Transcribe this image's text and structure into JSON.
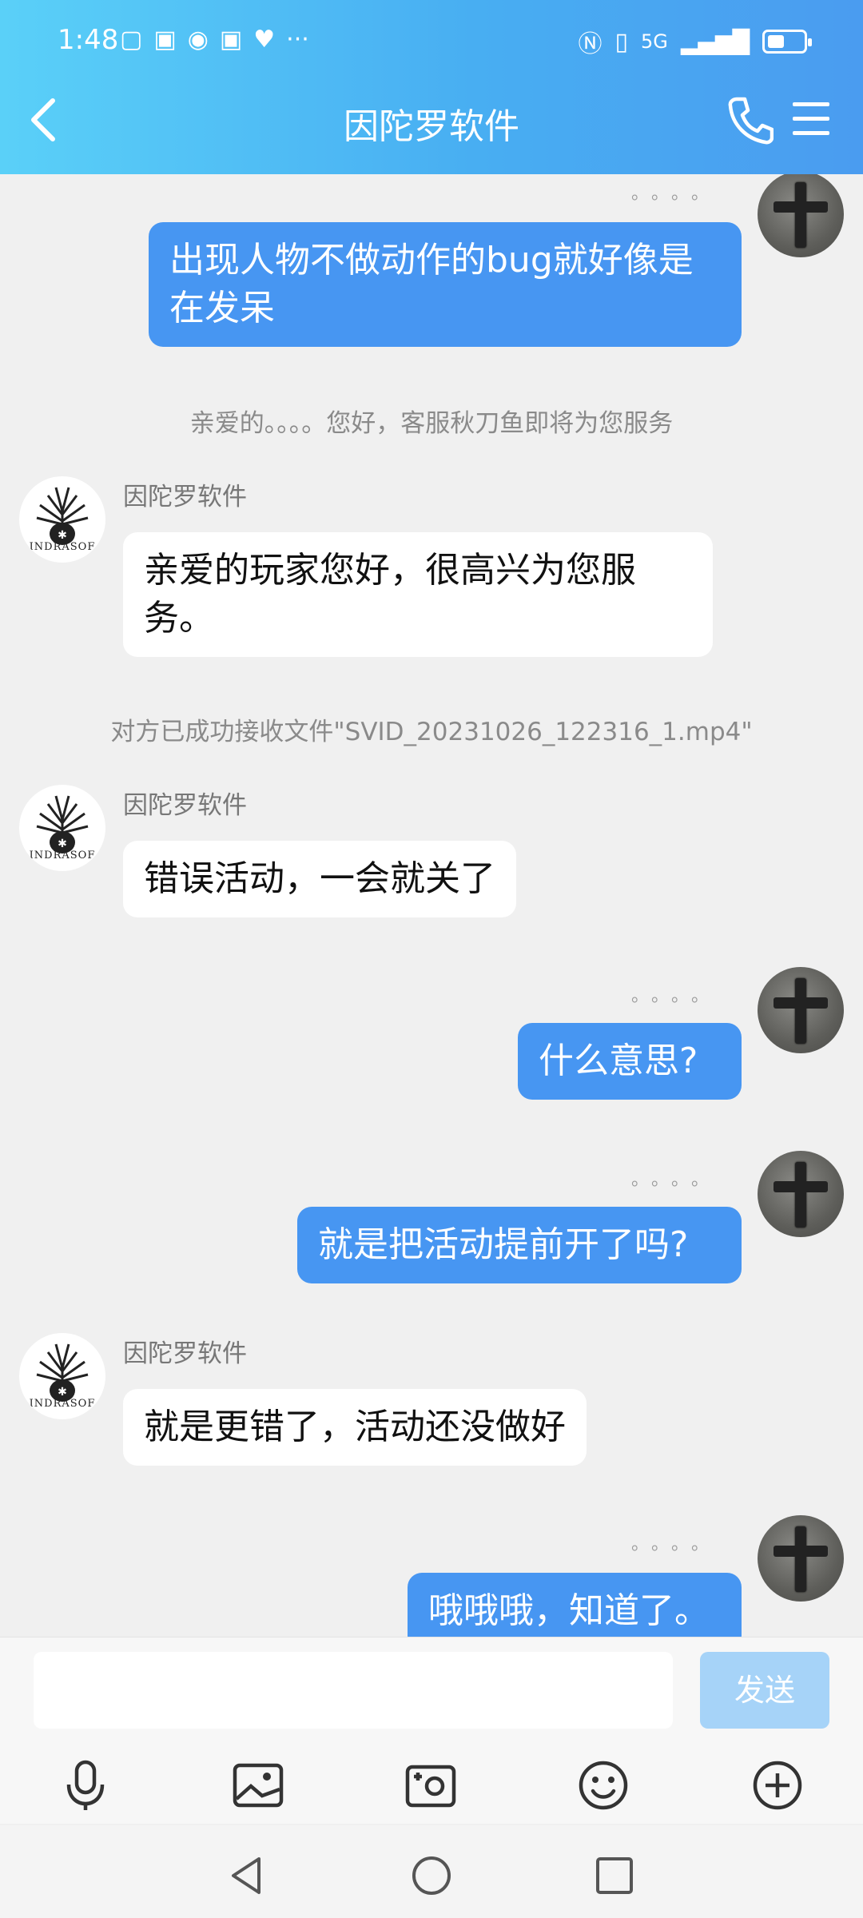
{
  "status_bar": {
    "time": "1:48",
    "left_icons": [
      "tv-icon",
      "app-icon",
      "play-icon",
      "app-icon",
      "heart-icon",
      "more-icon"
    ],
    "network": "5G"
  },
  "header": {
    "title": "因陀罗软件"
  },
  "messages": [
    {
      "type": "outgoing",
      "text": "出现人物不做动作的bug就好像是在发呆",
      "read_dots": "。。。。"
    },
    {
      "type": "system",
      "text": "亲爱的。。。。您好，客服秋刀鱼即将为您服务"
    },
    {
      "type": "incoming",
      "sender": "因陀罗软件",
      "text": "亲爱的玩家您好，很高兴为您服务。",
      "avatar_text": "INDRASOF"
    },
    {
      "type": "system",
      "text": "对方已成功接收文件\"SVID_20231026_122316_1.mp4\""
    },
    {
      "type": "incoming",
      "sender": "因陀罗软件",
      "text": "错误活动，一会就关了",
      "avatar_text": "INDRASOF"
    },
    {
      "type": "outgoing",
      "text": "什么意思?",
      "read_dots": "。。。。"
    },
    {
      "type": "outgoing",
      "text": "就是把活动提前开了吗?",
      "read_dots": "。。。。"
    },
    {
      "type": "incoming",
      "sender": "因陀罗软件",
      "text": "就是更错了，活动还没做好",
      "avatar_text": "INDRASOF"
    },
    {
      "type": "outgoing",
      "text": "哦哦哦，知道了。",
      "read_dots": "。。。。"
    }
  ],
  "composer": {
    "input_value": "",
    "send_label": "发送"
  },
  "toolbar": [
    "mic-icon",
    "image-icon",
    "camera-icon",
    "emoji-icon",
    "plus-icon"
  ],
  "colors": {
    "header_start": "#5ad0f8",
    "header_end": "#4a9cf0",
    "bubble_me": "#4796f2",
    "bubble_them": "#ffffff",
    "send_disabled": "#a6d3f8",
    "chat_bg": "#f0f0f0"
  }
}
